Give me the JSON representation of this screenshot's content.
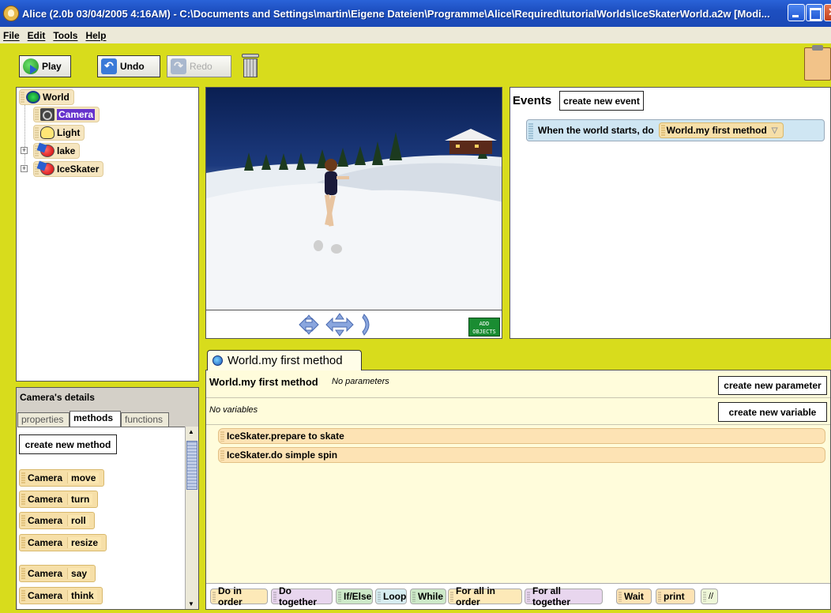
{
  "window": {
    "title": "Alice (2.0b 03/04/2005 4:16AM) - C:\\Documents and Settings\\martin\\Eigene Dateien\\Programme\\Alice\\Required\\tutorialWorlds\\IceSkaterWorld.a2w [Modi..."
  },
  "menu": {
    "file": "File",
    "edit": "Edit",
    "tools": "Tools",
    "help": "Help"
  },
  "toolbar": {
    "play": "Play",
    "undo": "Undo",
    "redo": "Redo"
  },
  "tree": {
    "world": "World",
    "camera": "Camera",
    "light": "Light",
    "lake": "lake",
    "iceskater": "IceSkater"
  },
  "scene": {
    "add_objects_line1": "ADD",
    "add_objects_line2": "OBJECTS"
  },
  "events": {
    "header": "Events",
    "create_button": "create new event",
    "row_text": "When the world starts,  do",
    "row_method": "World.my first method"
  },
  "details": {
    "title": "Camera's details",
    "tabs": {
      "properties": "properties",
      "methods": "methods",
      "functions": "functions"
    },
    "create_method": "create new method",
    "methods": [
      {
        "obj": "Camera",
        "verb": "move"
      },
      {
        "obj": "Camera",
        "verb": "turn"
      },
      {
        "obj": "Camera",
        "verb": "roll"
      },
      {
        "obj": "Camera",
        "verb": "resize"
      },
      {
        "obj": "Camera",
        "verb": "say"
      },
      {
        "obj": "Camera",
        "verb": "think"
      }
    ]
  },
  "editor": {
    "tab_label": "World.my first method",
    "method_name": "World.my first method",
    "params_note": "No parameters",
    "create_param": "create new parameter",
    "vars_note": "No variables",
    "create_var": "create new variable",
    "statements": [
      "IceSkater.prepare to skate",
      "IceSkater.do simple spin"
    ]
  },
  "controls": {
    "do_in_order": "Do in order",
    "do_together": "Do together",
    "if_else": "If/Else",
    "loop": "Loop",
    "while": "While",
    "for_all_in_order": "For all in order",
    "for_all_together": "For all together",
    "wait": "Wait",
    "print": "print",
    "comment": "//"
  },
  "colors": {
    "background": "#d8dc1c",
    "editor_bg": "#fffcdb",
    "method_tile": "#f6dfa8",
    "event_row": "#cfe6f3",
    "title_bar": "#2a63d8"
  }
}
